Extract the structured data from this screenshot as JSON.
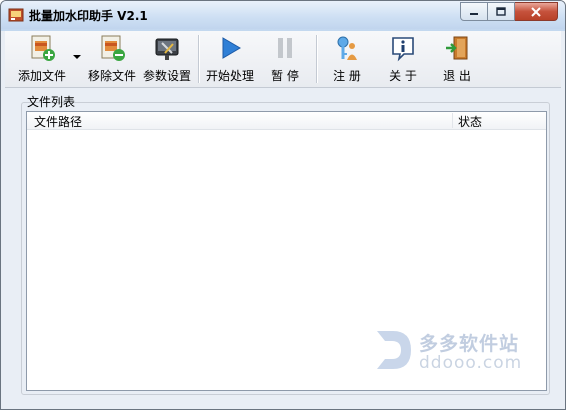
{
  "window": {
    "title": "批量加水印助手 V2.1",
    "app_icon": "watermark-app-icon"
  },
  "window_controls": {
    "minimize": "minimize-icon",
    "maximize": "maximize-icon",
    "close": "close-icon"
  },
  "toolbar": {
    "add_files": "添加文件",
    "remove_files": "移除文件",
    "settings": "参数设置",
    "start": "开始处理",
    "pause": "暂 停",
    "register": "注 册",
    "about": "关 于",
    "exit": "退 出"
  },
  "file_list": {
    "group_label": "文件列表",
    "columns": [
      "文件路径",
      "状态"
    ],
    "rows": []
  },
  "watermark_overlay": {
    "text_cn": "多多软件站",
    "text_en": "ddooo.com"
  },
  "colors": {
    "title_bar": "#cddff3",
    "close_button": "#c6523c",
    "play_icon": "#2f7fd6",
    "pause_icon_disabled": "#b9bdc3"
  }
}
